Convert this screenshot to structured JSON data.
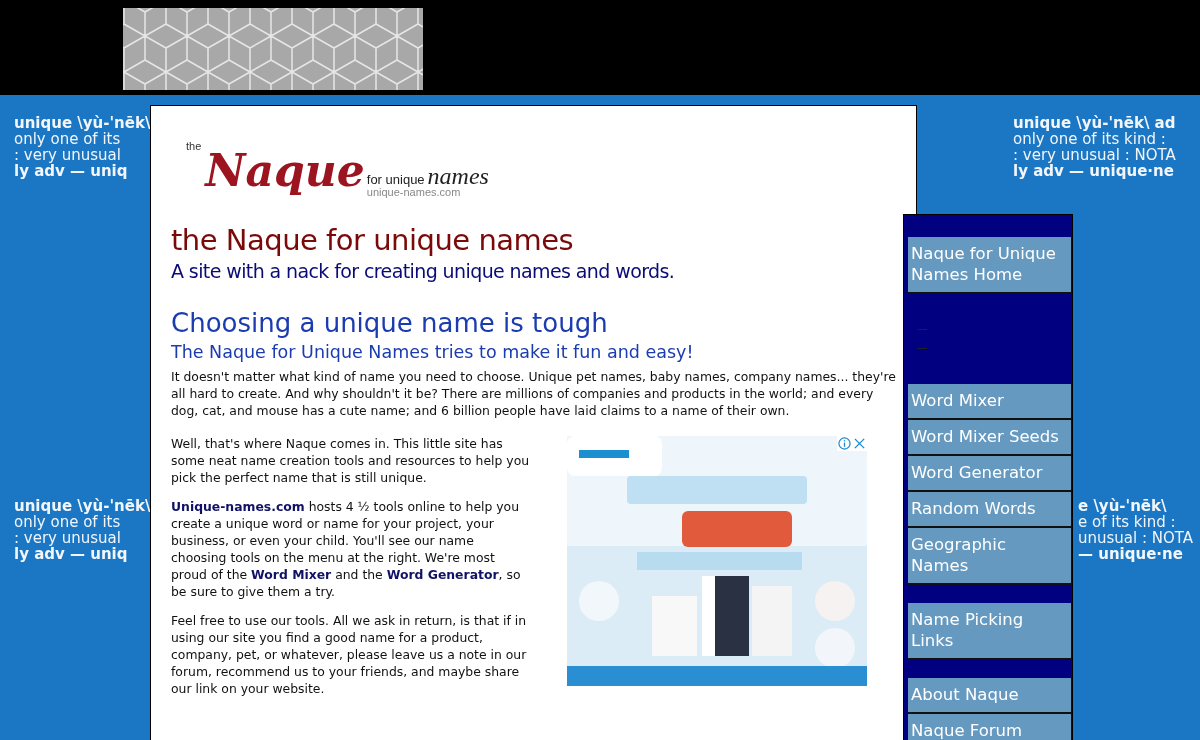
{
  "background_text": [
    {
      "lines": [
        "unique \\yù-'nēk\\",
        "only one of its",
        ": very unusual",
        "ly adv — uniq"
      ]
    },
    {
      "lines": [
        "unique \\yù-'nēk\\ ad",
        "only one of its kind :",
        ": very unusual : NOTA",
        "ly adv — unique·ne"
      ]
    },
    {
      "lines": [
        "unique \\yù-'nēk\\",
        "only one of its",
        ": very unusual",
        "ly adv — uniq"
      ]
    },
    {
      "lines": [
        "e \\yù-'nēk\\",
        "e of its kind :",
        "unusual : NOTA",
        "— unique·ne"
      ]
    }
  ],
  "logo": {
    "small": "the",
    "script": "Naque",
    "tagline": "for unique",
    "names": "names",
    "url": "unique-names.com"
  },
  "title": "the Naque for unique names",
  "subtitle": "A site with a nack for creating unique names and words.",
  "heading": "Choosing a unique name is tough",
  "subheading": "The Naque for Unique Names tries to make it fun and easy!",
  "intro": "It doesn't matter what kind of name you need to choose. Unique pet names, baby names, company names... they're all hard to create. And why shouldn't it be? There are millions of companies and products in the world; and every dog, cat, and mouse has a cute name; and 6 billion people have laid claims to a name of their own.",
  "paragraphs": [
    "Well, that's where Naque comes in. This little site has some neat name creation tools and resources to help you pick the perfect name that is still unique.",
    "**Unique-names.com** hosts 4 ½ tools online to help you create a unique word or name for your project, your business, or even your child. You'll see our name choosing tools on the menu at the right. We're most proud of the **Word Mixer** and the **Word Generator**, so be sure to give them a try.",
    "Feel free to use our tools. All we ask in return, is that if in using our site you find a good name for a product, company, pet, or whatever, please leave us a note in our forum, recommend us to your friends, and maybe share our link on your website."
  ],
  "ad": {
    "kind": "picture"
  },
  "menu": [
    {
      "kind": "link",
      "label": "Naque for Unique Names Home"
    },
    {
      "kind": "dashes"
    },
    {
      "kind": "link",
      "label": "Word Mixer"
    },
    {
      "kind": "link",
      "label": "Word Mixer Seeds"
    },
    {
      "kind": "link",
      "label": "Word Generator"
    },
    {
      "kind": "link",
      "label": "Random Words"
    },
    {
      "kind": "link",
      "label": "Geographic Names"
    },
    {
      "kind": "gap"
    },
    {
      "kind": "link",
      "label": "Name Picking Links"
    },
    {
      "kind": "gap"
    },
    {
      "kind": "link",
      "label": "About Naque"
    },
    {
      "kind": "link",
      "label": "Naque Forum"
    }
  ]
}
